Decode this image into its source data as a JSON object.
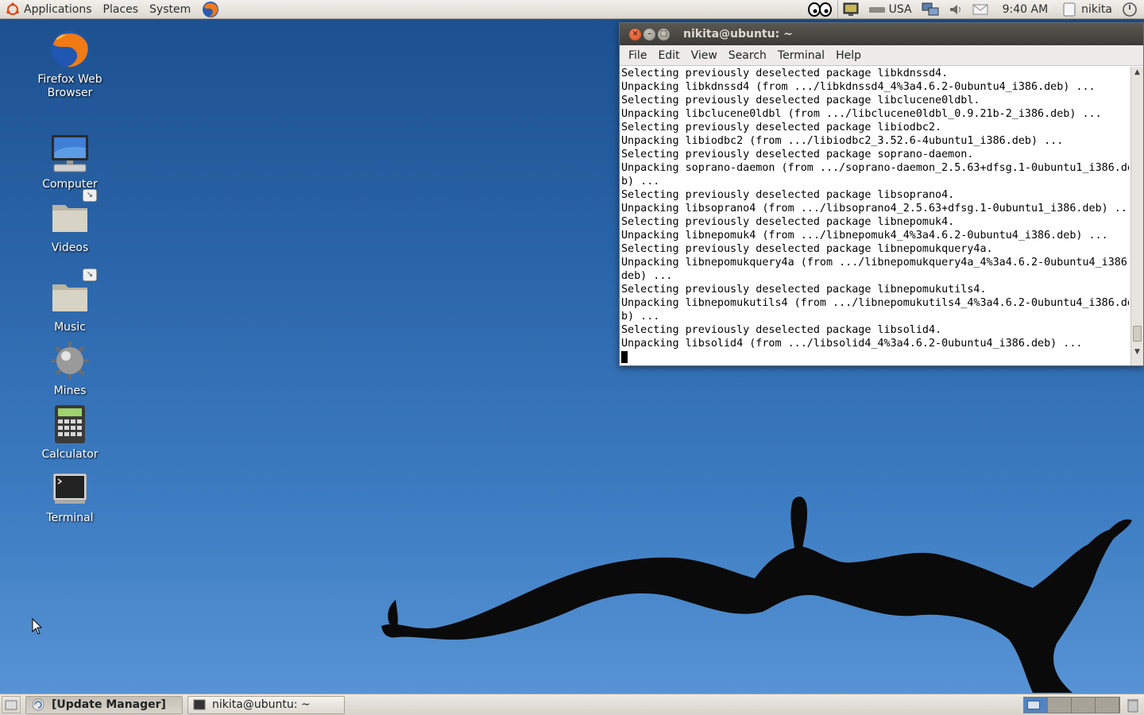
{
  "top_panel": {
    "menus": [
      {
        "label": "Applications",
        "icon": "ubuntu-logo-icon"
      },
      {
        "label": "Places"
      },
      {
        "label": "System"
      }
    ],
    "keyboard_layout": "USA",
    "clock": "9:40 AM",
    "user": "nikita",
    "tray_icons": [
      "accessibility-eyes-icon",
      "display-icon",
      "keyboard-icon",
      "network-icon",
      "volume-icon",
      "mail-icon",
      "user-icon",
      "power-icon"
    ]
  },
  "desktop": {
    "icons": [
      {
        "label": "Firefox Web Browser",
        "icon": "firefox-icon"
      },
      {
        "label": "Computer",
        "icon": "computer-icon"
      },
      {
        "label": "Videos",
        "icon": "folder-icon",
        "link": true
      },
      {
        "label": "Music",
        "icon": "folder-icon",
        "link": true
      },
      {
        "label": "Mines",
        "icon": "mines-icon"
      },
      {
        "label": "Calculator",
        "icon": "calculator-icon"
      },
      {
        "label": "Terminal",
        "icon": "terminal-icon"
      }
    ]
  },
  "terminal": {
    "title": "nikita@ubuntu: ~",
    "menu": [
      "File",
      "Edit",
      "View",
      "Search",
      "Terminal",
      "Help"
    ],
    "lines": [
      "Selecting previously deselected package libkdnssd4.",
      "Unpacking libkdnssd4 (from .../libkdnssd4_4%3a4.6.2-0ubuntu4_i386.deb) ...",
      "Selecting previously deselected package libclucene0ldbl.",
      "Unpacking libclucene0ldbl (from .../libclucene0ldbl_0.9.21b-2_i386.deb) ...",
      "Selecting previously deselected package libiodbc2.",
      "Unpacking libiodbc2 (from .../libiodbc2_3.52.6-4ubuntu1_i386.deb) ...",
      "Selecting previously deselected package soprano-daemon.",
      "Unpacking soprano-daemon (from .../soprano-daemon_2.5.63+dfsg.1-0ubuntu1_i386.de",
      "b) ...",
      "Selecting previously deselected package libsoprano4.",
      "Unpacking libsoprano4 (from .../libsoprano4_2.5.63+dfsg.1-0ubuntu1_i386.deb) ...",
      "Selecting previously deselected package libnepomuk4.",
      "Unpacking libnepomuk4 (from .../libnepomuk4_4%3a4.6.2-0ubuntu4_i386.deb) ...",
      "Selecting previously deselected package libnepomukquery4a.",
      "Unpacking libnepomukquery4a (from .../libnepomukquery4a_4%3a4.6.2-0ubuntu4_i386.",
      "deb) ...",
      "Selecting previously deselected package libnepomukutils4.",
      "Unpacking libnepomukutils4 (from .../libnepomukutils4_4%3a4.6.2-0ubuntu4_i386.de",
      "b) ...",
      "Selecting previously deselected package libsolid4.",
      "Unpacking libsolid4 (from .../libsolid4_4%3a4.6.2-0ubuntu4_i386.deb) ..."
    ]
  },
  "taskbar": {
    "tasks": [
      {
        "label": "[Update Manager]",
        "icon": "update-manager-icon",
        "active": true
      },
      {
        "label": "nikita@ubuntu: ~",
        "icon": "terminal-icon",
        "active": false
      }
    ],
    "workspace_count": 4,
    "active_workspace": 1
  },
  "colors": {
    "desktop_top": "#1c4f8e",
    "desktop_bottom": "#5a96d6",
    "panel": "#dcd8d0",
    "titlebar": "#3c3b37",
    "close_button": "#d8471b"
  }
}
